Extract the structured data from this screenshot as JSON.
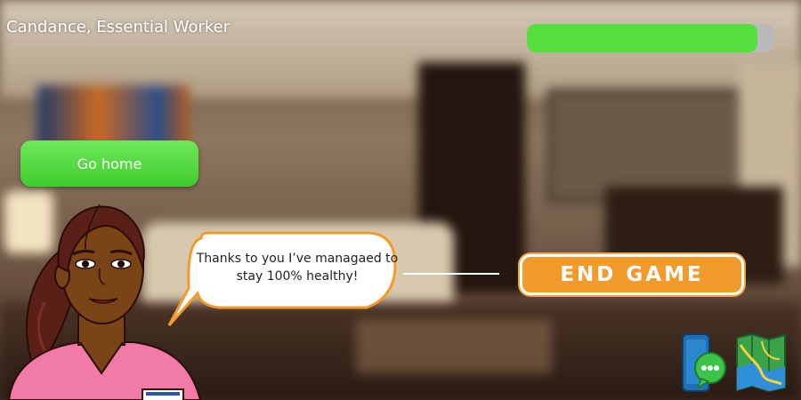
{
  "character": {
    "name_title": "Candance, Essential Worker"
  },
  "health": {
    "level_percent": 93,
    "fill_color": "#55df3c",
    "track_color": "#b9b9b9"
  },
  "actions": {
    "go_home_label": "Go home",
    "end_game_label": "END GAME"
  },
  "dialogue": {
    "line1": "Thanks to you I’ve managaed to",
    "line2": "stay 100% healthy!"
  },
  "icons": {
    "phone": "phone-chat-icon",
    "map": "map-icon"
  },
  "colors": {
    "accent_green": "#4bd636",
    "accent_orange": "#f29a2c",
    "bubble_border": "#f29a2c"
  }
}
